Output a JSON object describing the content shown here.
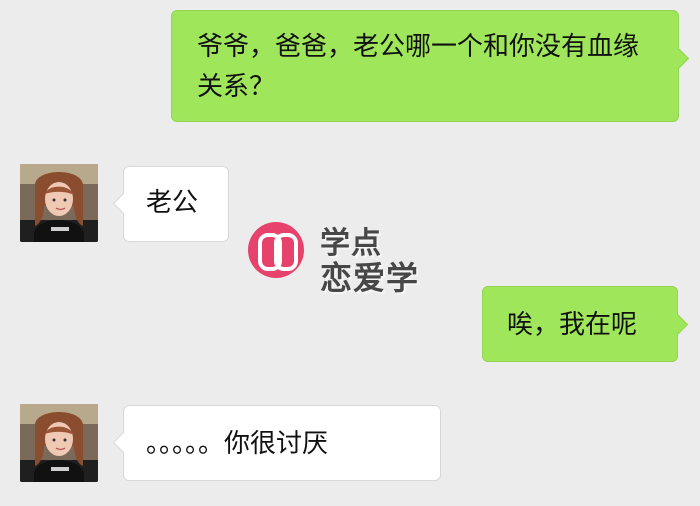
{
  "messages": [
    {
      "sender": "self",
      "text": "爷爷，爸爸，老公哪一个和你没有血缘关系？"
    },
    {
      "sender": "other",
      "text": "老公"
    },
    {
      "sender": "self",
      "text": "唉，我在呢"
    },
    {
      "sender": "other",
      "text": "。。。。。你很讨厌"
    }
  ],
  "watermark": {
    "line1": "学点",
    "line2": "恋爱学"
  },
  "colors": {
    "background": "#ececec",
    "outgoing_bubble": "#9fe65a",
    "incoming_bubble": "#ffffff",
    "logo": "#e6426b"
  }
}
